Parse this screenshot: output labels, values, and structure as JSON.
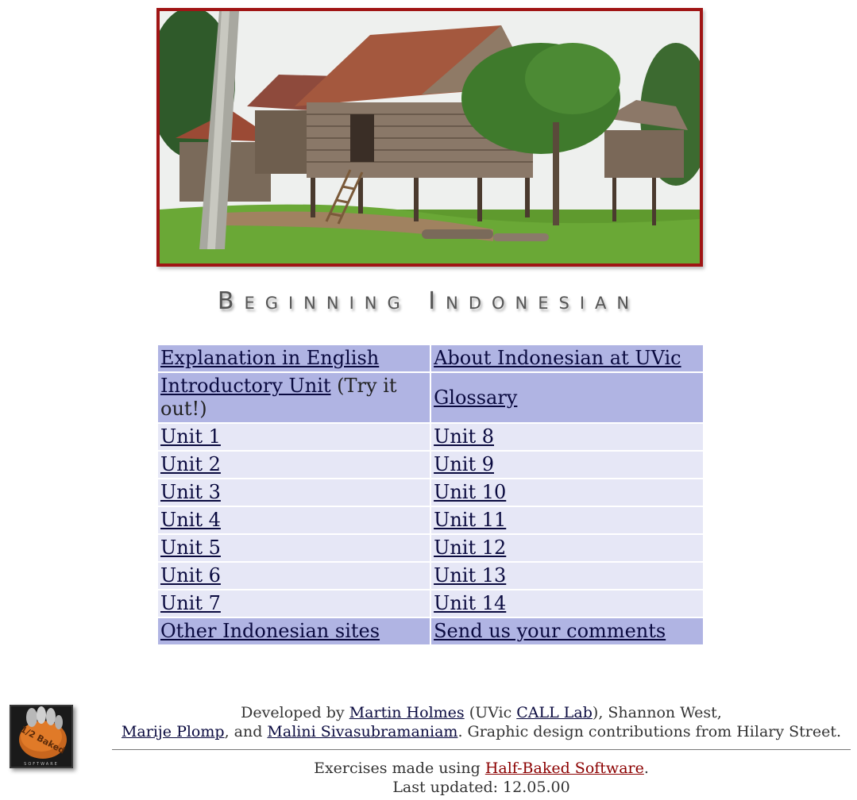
{
  "header": {
    "image_alt": "Photo of traditional wooden stilt houses in an Indonesian village",
    "title": "Beginning Indonesian"
  },
  "menu": {
    "rows": [
      {
        "left": {
          "link": "Explanation in English",
          "suffix": ""
        },
        "right": {
          "link": "About Indonesian at UVic"
        }
      },
      {
        "left": {
          "link": "Introductory Unit",
          "suffix": " (Try it out!)"
        },
        "right": {
          "link": "Glossary"
        }
      },
      {
        "left": {
          "link": "Unit 1",
          "suffix": ""
        },
        "right": {
          "link": "Unit 8"
        }
      },
      {
        "left": {
          "link": "Unit 2",
          "suffix": ""
        },
        "right": {
          "link": "Unit 9"
        }
      },
      {
        "left": {
          "link": "Unit 3",
          "suffix": ""
        },
        "right": {
          "link": "Unit 10"
        }
      },
      {
        "left": {
          "link": "Unit 4",
          "suffix": ""
        },
        "right": {
          "link": "Unit 11"
        }
      },
      {
        "left": {
          "link": "Unit 5",
          "suffix": ""
        },
        "right": {
          "link": "Unit 12"
        }
      },
      {
        "left": {
          "link": "Unit 6",
          "suffix": ""
        },
        "right": {
          "link": "Unit 13"
        }
      },
      {
        "left": {
          "link": "Unit 7",
          "suffix": ""
        },
        "right": {
          "link": "Unit 14"
        }
      },
      {
        "left": {
          "link": "Other Indonesian sites",
          "suffix": ""
        },
        "right": {
          "link": "Send us your comments"
        }
      }
    ]
  },
  "footer": {
    "logo_text": "1/2 Baked",
    "logo_subtext": "SOFTWARE",
    "credits": {
      "prefix": "Developed by ",
      "author1": "Martin Holmes",
      "mid1": " (UVic ",
      "lab": "CALL Lab",
      "mid2": "), Shannon West,",
      "author2": "Marije Plomp",
      "mid3": ", and ",
      "author3": "Malini Sivasubramaniam",
      "suffix": ". Graphic design contributions from Hilary Street."
    },
    "tools": {
      "prefix": "Exercises made using ",
      "link": "Half-Baked Software",
      "suffix": "."
    },
    "updated": "Last updated: 12.05.00"
  },
  "colors": {
    "frame": "#a01515",
    "row_dark": "#b0b4e3",
    "row_light": "#e6e7f6",
    "link": "#0a0a3f",
    "tools_link": "#8b0000"
  }
}
